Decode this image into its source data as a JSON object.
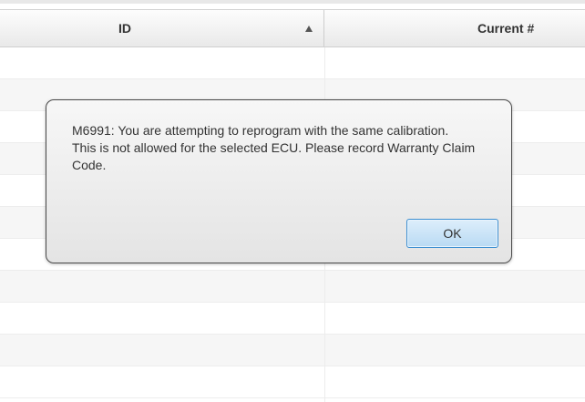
{
  "table": {
    "columns": [
      {
        "label": "ID",
        "sort": "ascending"
      },
      {
        "label": "Current #"
      }
    ],
    "rows": [
      {},
      {},
      {},
      {},
      {},
      {},
      {},
      {},
      {},
      {},
      {}
    ]
  },
  "dialog": {
    "message": "M6991: You are attempting to reprogram with the same calibration.\nThis is not allowed for the selected ECU. Please record Warranty Claim Code.",
    "ok_label": "OK"
  },
  "icons": {
    "sort": "sort-ascending-icon"
  },
  "colors": {
    "dialog_border": "#4a4a4a",
    "button_border": "#3d8fd1",
    "button_fill": "#b9daf3"
  }
}
